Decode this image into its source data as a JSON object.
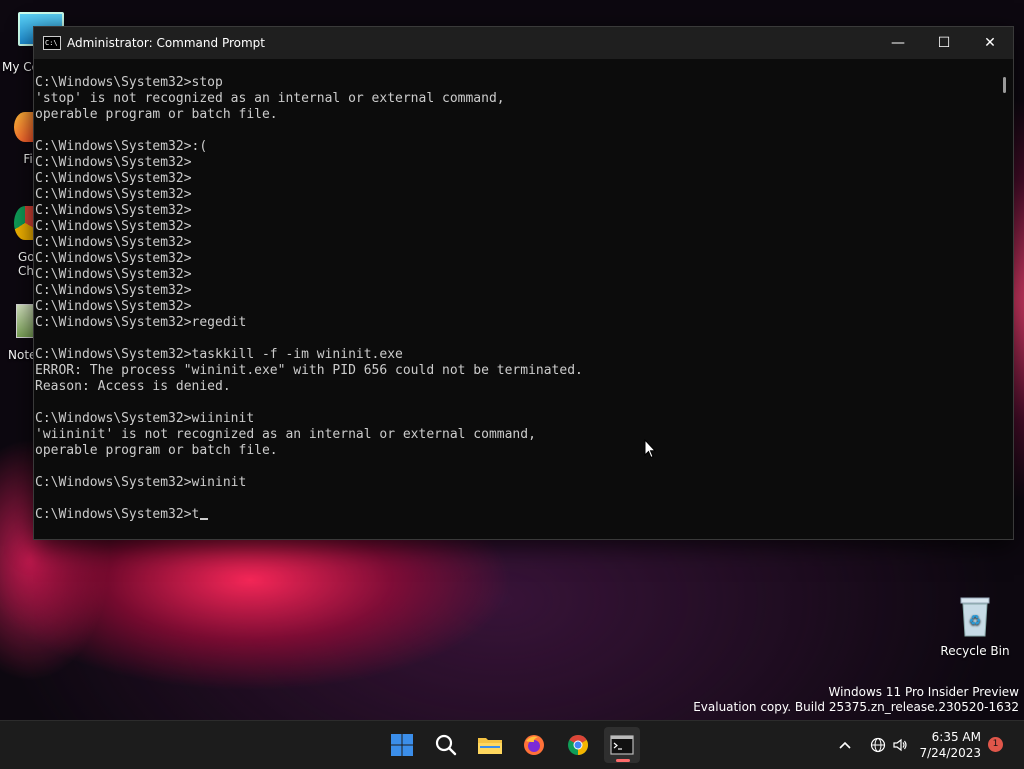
{
  "desktop": {
    "icons": [
      {
        "label": "My Co"
      },
      {
        "label": "Fi"
      },
      {
        "label": "Go\nCh"
      },
      {
        "label": "Note"
      }
    ],
    "recycle_bin": "Recycle Bin"
  },
  "window": {
    "title": "Administrator: Command Prompt",
    "minimize": "—",
    "maximize": "☐",
    "close": "✕"
  },
  "console": {
    "lines": [
      "",
      "C:\\Windows\\System32>stop",
      "'stop' is not recognized as an internal or external command,",
      "operable program or batch file.",
      "",
      "C:\\Windows\\System32>:(",
      "C:\\Windows\\System32>",
      "C:\\Windows\\System32>",
      "C:\\Windows\\System32>",
      "C:\\Windows\\System32>",
      "C:\\Windows\\System32>",
      "C:\\Windows\\System32>",
      "C:\\Windows\\System32>",
      "C:\\Windows\\System32>",
      "C:\\Windows\\System32>",
      "C:\\Windows\\System32>",
      "C:\\Windows\\System32>regedit",
      "",
      "C:\\Windows\\System32>taskkill -f -im wininit.exe",
      "ERROR: The process \"wininit.exe\" with PID 656 could not be terminated.",
      "Reason: Access is denied.",
      "",
      "C:\\Windows\\System32>wiininit",
      "'wiininit' is not recognized as an internal or external command,",
      "operable program or batch file.",
      "",
      "C:\\Windows\\System32>wininit",
      ""
    ],
    "prompt_current": "C:\\Windows\\System32>t"
  },
  "watermark": {
    "line1": "Windows 11 Pro Insider Preview",
    "line2": "Evaluation copy. Build 25375.zn_release.230520-1632"
  },
  "taskbar": {
    "clock_time": "6:35 AM",
    "clock_date": "7/24/2023",
    "notification_count": "1"
  },
  "colors": {
    "console_bg": "#0c0c0c",
    "console_fg": "#cccccc",
    "titlebar_bg": "#1f1f1f",
    "taskbar_bg": "#1c1c1c",
    "start_blue": "#3b8eea",
    "folder_yellow": "#f4c242"
  }
}
